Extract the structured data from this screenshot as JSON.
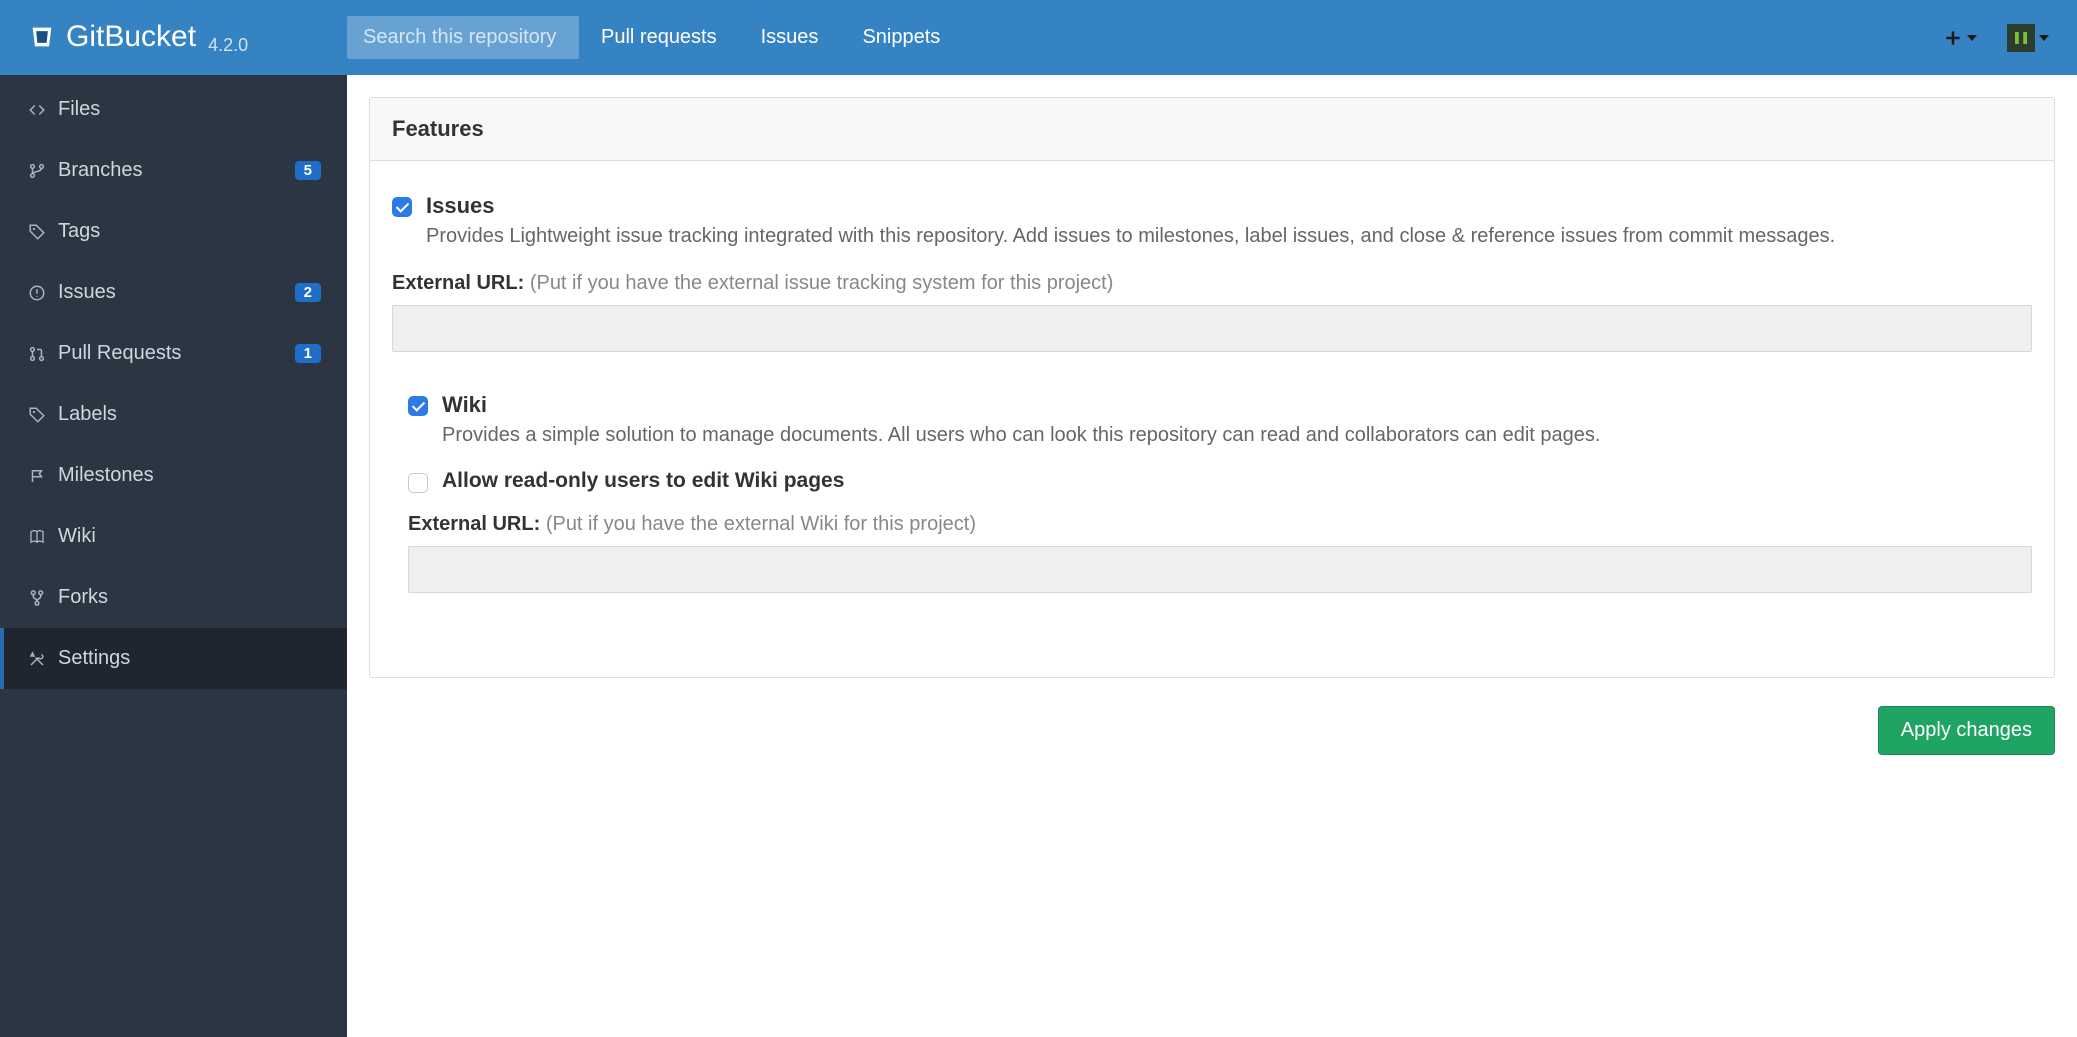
{
  "app": {
    "name": "GitBucket",
    "version": "4.2.0"
  },
  "header": {
    "search_placeholder": "Search this repository",
    "links": {
      "pull_requests": "Pull requests",
      "issues": "Issues",
      "snippets": "Snippets"
    }
  },
  "sidebar": {
    "items": [
      {
        "label": "Files",
        "count": null
      },
      {
        "label": "Branches",
        "count": "5"
      },
      {
        "label": "Tags",
        "count": null
      },
      {
        "label": "Issues",
        "count": "2"
      },
      {
        "label": "Pull Requests",
        "count": "1"
      },
      {
        "label": "Labels",
        "count": null
      },
      {
        "label": "Milestones",
        "count": null
      },
      {
        "label": "Wiki",
        "count": null
      },
      {
        "label": "Forks",
        "count": null
      },
      {
        "label": "Settings",
        "count": null
      }
    ]
  },
  "panel": {
    "title": "Features",
    "issues": {
      "title": "Issues",
      "desc": "Provides Lightweight issue tracking integrated with this repository. Add issues to milestones, label issues, and close & reference issues from commit messages.",
      "checked": true,
      "ext_label": "External URL:",
      "ext_hint": "(Put if you have the external issue tracking system for this project)",
      "ext_value": ""
    },
    "wiki": {
      "title": "Wiki",
      "desc": "Provides a simple solution to manage documents. All users who can look this repository can read and collaborators can edit pages.",
      "checked": true,
      "allow_ro_label": "Allow read-only users to edit Wiki pages",
      "allow_ro_checked": false,
      "ext_label": "External URL:",
      "ext_hint": "(Put if you have the external Wiki for this project)",
      "ext_value": ""
    },
    "apply_label": "Apply changes"
  },
  "colors": {
    "brand": "#3683c3",
    "sidebar_bg": "#2c3643",
    "accent": "#2c7be5",
    "success": "#1fa463"
  }
}
